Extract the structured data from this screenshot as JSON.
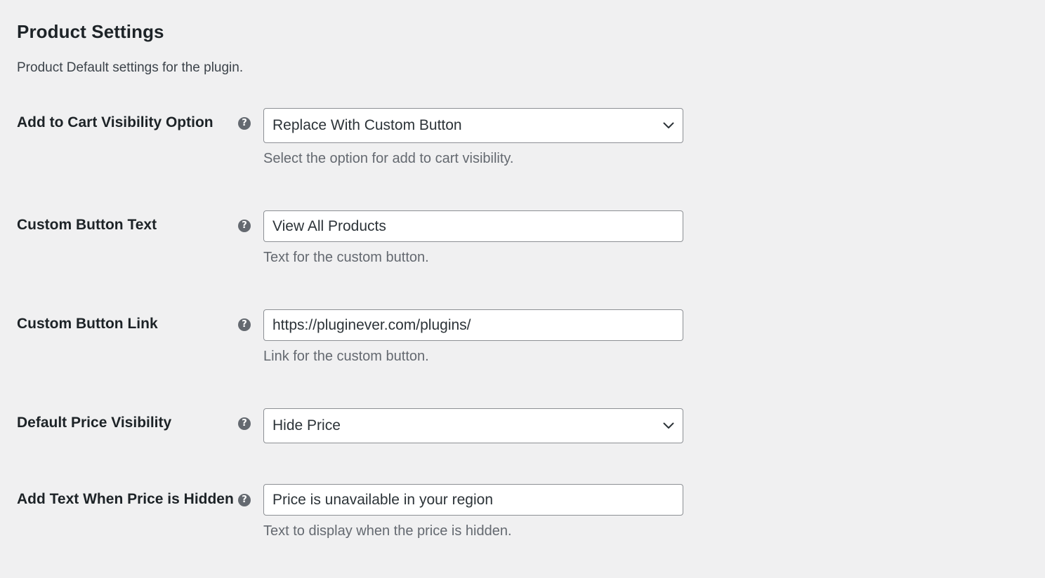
{
  "page": {
    "title": "Product Settings",
    "description": "Product Default settings for the plugin."
  },
  "icons": {
    "help": "question-circle-icon",
    "chevron": "chevron-down-icon"
  },
  "help_glyph": "?",
  "rows": [
    {
      "label": "Add to Cart Visibility Option",
      "type": "select",
      "value": "Replace With Custom Button",
      "description": "Select the option for add to cart visibility."
    },
    {
      "label": "Custom Button Text",
      "type": "text",
      "value": "View All Products",
      "description": "Text for the custom button."
    },
    {
      "label": "Custom Button Link",
      "type": "text",
      "value": "https://pluginever.com/plugins/",
      "description": "Link for the custom button."
    },
    {
      "label": "Default Price Visibility",
      "type": "select",
      "value": "Hide Price",
      "description": ""
    },
    {
      "label": "Add Text When Price is Hidden",
      "type": "text",
      "value": "Price is unavailable in your region",
      "description": "Text to display when the price is hidden."
    }
  ],
  "colors": {
    "background": "#f0f0f1",
    "text": "#1d2327",
    "muted": "#646970",
    "border": "#8c8f94",
    "field_bg": "#ffffff"
  }
}
